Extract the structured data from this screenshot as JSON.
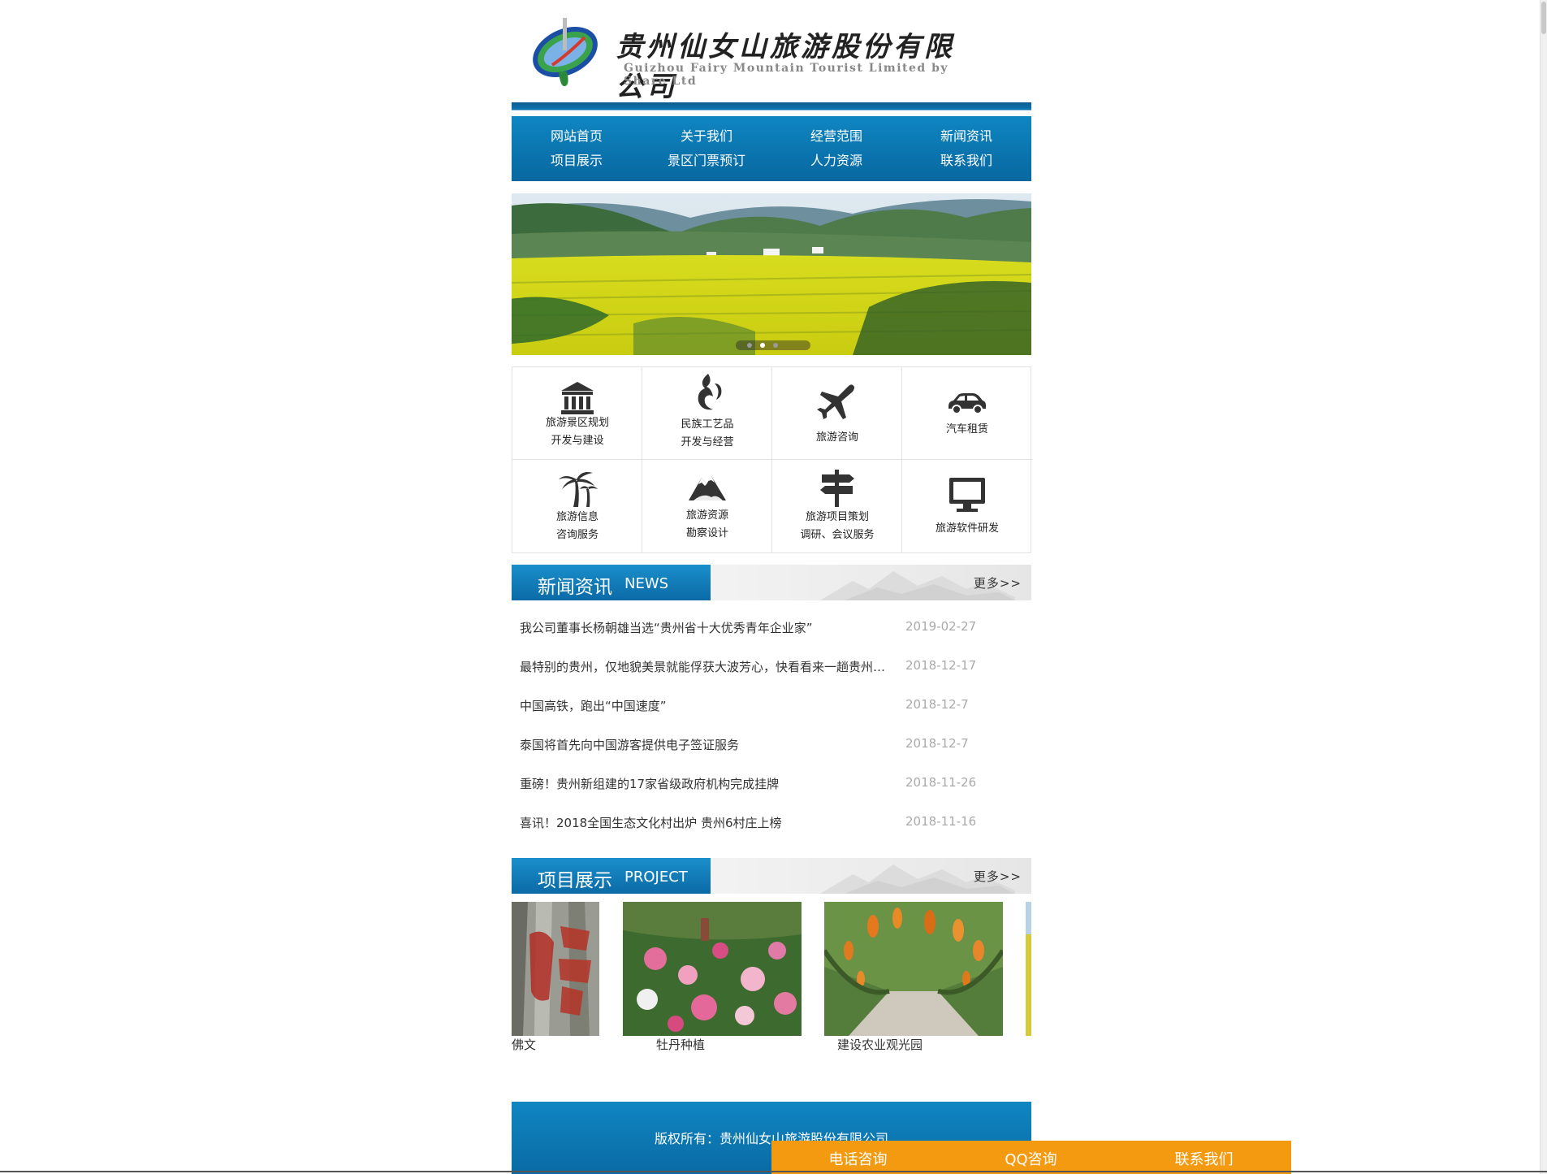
{
  "header": {
    "company_cn": "贵州仙女山旅游股份有限公司",
    "company_en": "Guizhou Fairy Mountain Tourist Limited by Share Ltd"
  },
  "nav": {
    "items": [
      {
        "label": "网站首页"
      },
      {
        "label": "关于我们"
      },
      {
        "label": "经营范围"
      },
      {
        "label": "新闻资讯"
      },
      {
        "label": "项目展示"
      },
      {
        "label": "景区门票预订"
      },
      {
        "label": "人力资源"
      },
      {
        "label": "联系我们"
      }
    ]
  },
  "banner": {
    "slide_count": 3,
    "active_slide": 1
  },
  "services": [
    {
      "icon": "building-icon",
      "line1": "旅游景区规划",
      "line2": "开发与建设"
    },
    {
      "icon": "flame-swirl-icon",
      "line1": "民族工艺品",
      "line2": "开发与经营"
    },
    {
      "icon": "airplane-icon",
      "line1": "旅游咨询",
      "line2": ""
    },
    {
      "icon": "car-icon",
      "line1": "汽车租赁",
      "line2": ""
    },
    {
      "icon": "palm-tree-icon",
      "line1": "旅游信息",
      "line2": "咨询服务"
    },
    {
      "icon": "mountain-icon",
      "line1": "旅游资源",
      "line2": "勘察设计"
    },
    {
      "icon": "signpost-icon",
      "line1": "旅游项目策划",
      "line2": "调研、会议服务"
    },
    {
      "icon": "monitor-icon",
      "line1": "旅游软件研发",
      "line2": ""
    }
  ],
  "news_section": {
    "title_cn": "新闻资讯",
    "title_en": "NEWS",
    "more": "更多>>",
    "items": [
      {
        "title": "我公司董事长杨朝雄当选“贵州省十大优秀青年企业家”",
        "date": "2019-02-27"
      },
      {
        "title": "最特别的贵州，仅地貌美景就能俘获大波芳心，快看看来一趟贵州的理由吧！",
        "date": "2018-12-17"
      },
      {
        "title": "中国高铁，跑出“中国速度”",
        "date": "2018-12-7"
      },
      {
        "title": "泰国将首先向中国游客提供电子签证服务",
        "date": "2018-12-7"
      },
      {
        "title": "重磅！贵州新组建的17家省级政府机构完成挂牌",
        "date": "2018-11-26"
      },
      {
        "title": "喜讯！2018全国生态文化村出炉 贵州6村庄上榜",
        "date": "2018-11-16"
      }
    ]
  },
  "project_section": {
    "title_cn": "项目展示",
    "title_en": "PROJECT",
    "more": "更多>>",
    "items": [
      {
        "caption": "佛文"
      },
      {
        "caption": "牡丹种植"
      },
      {
        "caption": "建设农业观光园"
      },
      {
        "caption": ""
      }
    ]
  },
  "footer": {
    "copyright": "版权所有：贵州仙女山旅游股份有限公司"
  },
  "contact_bar": {
    "items": [
      {
        "label": "电话咨询"
      },
      {
        "label": "QQ咨询"
      },
      {
        "label": "联系我们"
      }
    ]
  },
  "colors": {
    "brand_blue": "#0a73ad",
    "contact_orange": "#f39a11"
  }
}
